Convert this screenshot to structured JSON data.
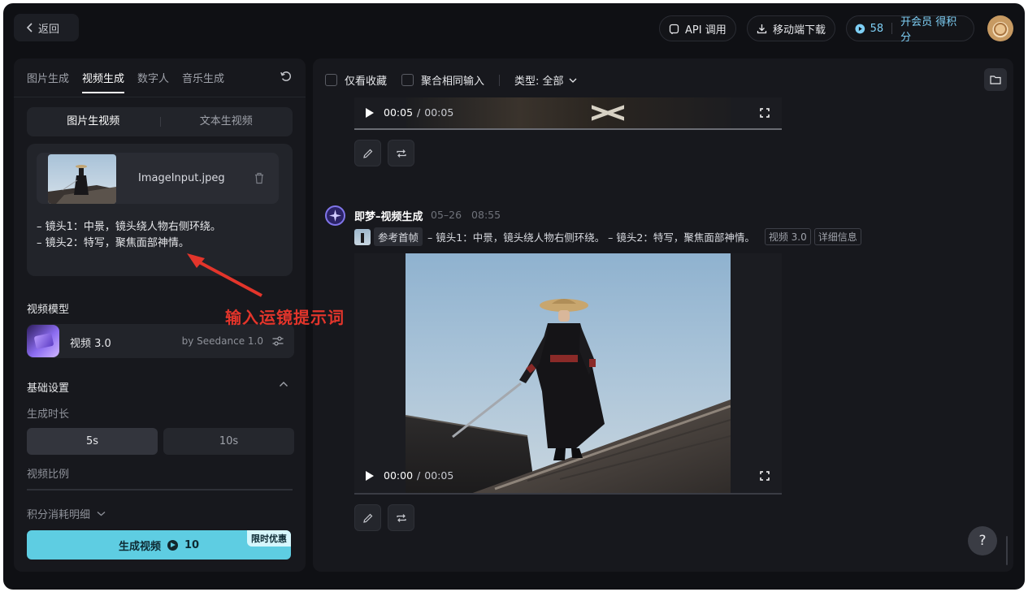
{
  "header": {
    "back_label": "返回",
    "api_label": "API 调用",
    "mobile_label": "移动端下载",
    "credits": "58",
    "vip_label": "开会员 得积分"
  },
  "left_panel": {
    "tabs": [
      {
        "label": "图片生成",
        "active": false
      },
      {
        "label": "视频生成",
        "active": true
      },
      {
        "label": "数字人",
        "active": false
      },
      {
        "label": "音乐生成",
        "active": false
      }
    ],
    "mode_tabs": [
      {
        "label": "图片生视频",
        "active": true
      },
      {
        "label": "文本生视频",
        "active": false
      }
    ],
    "file_name": "ImageInput.jpeg",
    "prompt_lines": [
      "– 镜头1：中景，镜头绕人物右侧环绕。",
      "– 镜头2：特写，聚焦面部神情。"
    ],
    "model_section_label": "视频模型",
    "model_name": "视频 3.0",
    "model_by": "by Seedance 1.0",
    "basic_settings_label": "基础设置",
    "duration_label": "生成时长",
    "durations": [
      "5s",
      "10s"
    ],
    "ratio_label": "视频比例",
    "cost_detail_label": "积分消耗明细",
    "generate_label": "生成视频",
    "generate_cost": "10",
    "promo_badge": "限时优惠"
  },
  "right_panel": {
    "filters": {
      "favorites_only": "仅看收藏",
      "merge_same_input": "聚合相同输入",
      "type_label": "类型: 全部"
    },
    "video_1": {
      "current_time": "00:05",
      "duration": "00:05"
    },
    "entry": {
      "title": "即梦–视频生成",
      "date": "05–26",
      "time": "08:55",
      "ref_label": "参考首帧",
      "prompt": "– 镜头1：中景，镜头绕人物右侧环绕。 – 镜头2：特写，聚焦面部神情。",
      "model_tag": "视频 3.0",
      "detail_tag": "详细信息"
    },
    "video_2": {
      "current_time": "00:00",
      "duration": "00:05"
    }
  },
  "annotation": {
    "text": "输入运镜提示词"
  },
  "help_label": "?",
  "colors": {
    "background": "#0f1014",
    "panel": "#17181d",
    "accent": "#5ecde2",
    "credit_blue": "#7ecff5",
    "annotation_red": "#e3352b"
  }
}
